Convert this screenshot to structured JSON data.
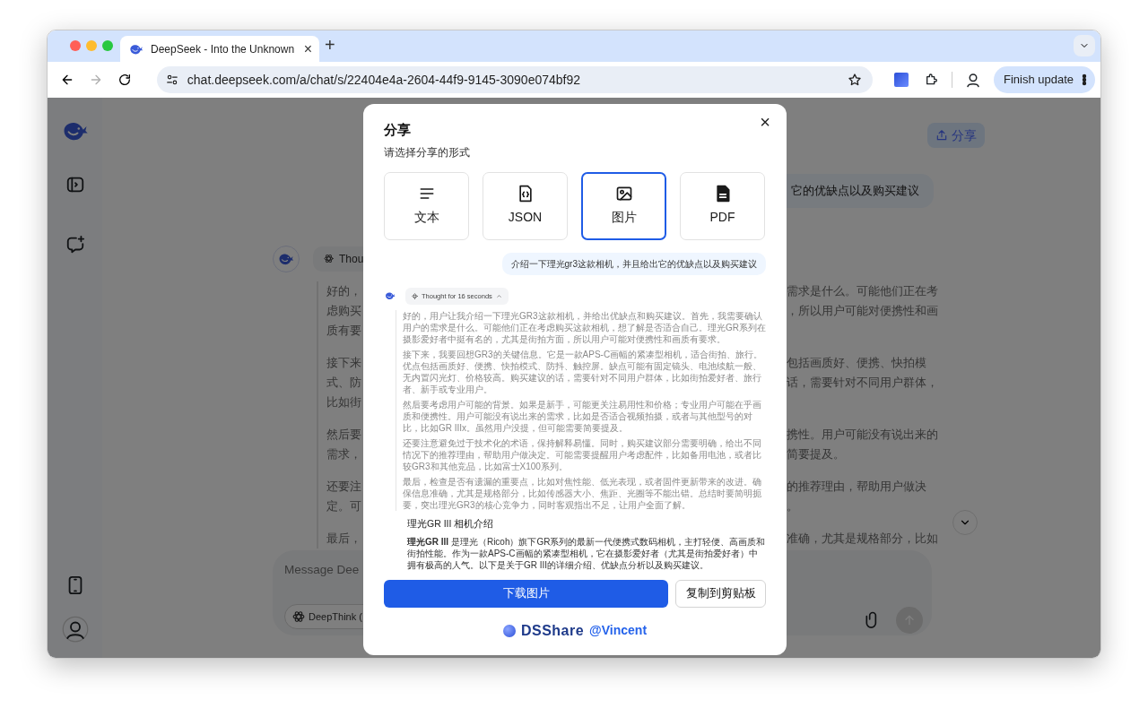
{
  "browser": {
    "tab_title": "DeepSeek - Into the Unknown",
    "tab_close": "×",
    "new_tab": "+",
    "forward_disabled": true,
    "url": "chat.deepseek.com/a/chat/s/22404e4a-2604-44f9-9145-3090e074bf92",
    "update_button": "Finish update"
  },
  "header": {
    "share_button": "分享"
  },
  "chat": {
    "user_message": "它的优缺点以及购买建议",
    "thought_chip": "Thou",
    "thinking": [
      {
        "lines": [
          {
            "left": "好的，",
            "right": "需求是什么。可能他们正在考"
          },
          {
            "left": "虑购买",
            "right": "，所以用户可能对便携性和画"
          },
          {
            "left": "质有要"
          }
        ]
      },
      {
        "lines": [
          {
            "left": "接下来",
            "right": "包括画质好、便携、快拍模"
          },
          {
            "left": "式、防",
            "right": "话，需要针对不同用户群体，"
          },
          {
            "left": "比如街"
          }
        ]
      },
      {
        "lines": [
          {
            "left": "然后要",
            "right": "携性。用户可能没有说出来的"
          },
          {
            "left": "需求，",
            "right": "简要提及。"
          }
        ]
      },
      {
        "lines": [
          {
            "left": "还要注",
            "right": "的推荐理由，帮助用户做决"
          },
          {
            "left": "定。可",
            "right": "。"
          }
        ]
      },
      {
        "lines": [
          {
            "left": "最后，",
            "right": "准确，尤其是规格部分，比如"
          }
        ]
      }
    ]
  },
  "composer": {
    "placeholder": "Message Dee",
    "deepthink": "DeepThink (",
    "send_disabled": true
  },
  "modal": {
    "title": "分享",
    "subtitle": "请选择分享的形式",
    "close": "×",
    "formats": [
      {
        "kind": "text",
        "label": "文本",
        "selected": false
      },
      {
        "kind": "json",
        "label": "JSON",
        "selected": false
      },
      {
        "kind": "image",
        "label": "图片",
        "selected": true
      },
      {
        "kind": "pdf",
        "label": "PDF",
        "selected": false
      }
    ],
    "preview": {
      "user_message": "介绍一下理光gr3这款相机，并且给出它的优缺点以及购买建议",
      "thought": "Thought for 16 seconds",
      "thinking": [
        "好的，用户让我介绍一下理光GR3这款相机，并给出优缺点和购买建议。首先，我需要确认用户的需求是什么。可能他们正在考虑购买这款相机，想了解是否适合自己。理光GR系列在摄影爱好者中挺有名的，尤其是街拍方面，所以用户可能对便携性和画质有要求。",
        "接下来，我要回想GR3的关键信息。它是一款APS-C画幅的紧凑型相机，适合街拍、旅行。优点包括画质好、便携、快拍模式、防抖、触控屏。缺点可能有固定镜头、电池续航一般、无内置闪光灯、价格较高。购买建议的话，需要针对不同用户群体，比如街拍爱好者、旅行者、新手或专业用户。",
        "然后要考虑用户可能的背景。如果是新手，可能更关注易用性和价格；专业用户可能在乎画质和便携性。用户可能没有说出来的需求，比如是否适合视频拍摄，或者与其他型号的对比，比如GR IIIx。虽然用户没提，但可能需要简要提及。",
        "还要注意避免过于技术化的术语，保持解释易懂。同时，购买建议部分需要明确，给出不同情况下的推荐理由，帮助用户做决定。可能需要提醒用户考虑配件，比如备用电池，或者比较GR3和其他竞品，比如富士X100系列。",
        "最后，检查是否有遗漏的重要点，比如对焦性能、低光表现，或者固件更新带来的改进。确保信息准确，尤其是规格部分，比如传感器大小、焦距、光圈等不能出错。总结时要简明扼要，突出理光GR3的核心竞争力，同时客观指出不足，让用户全面了解。"
      ],
      "heading": "理光GR III 相机介绍",
      "intro": "**理光GR III** 是理光（Ricoh）旗下GR系列的最新一代便携式数码相机，主打轻便、高画质和街拍性能。作为一款APS-C画幅的紧凑型相机，它在摄影爱好者（尤其是街拍爱好者）中拥有极高的人气。以下是关于GR III的详细介绍、优缺点分析以及购买建议。"
    },
    "buttons": [
      {
        "kind": "primary",
        "label": "下载图片"
      },
      {
        "kind": "secondary",
        "label": "复制到剪贴板"
      }
    ],
    "footer": {
      "brand": "DSShare",
      "handle": "@Vincent"
    }
  }
}
